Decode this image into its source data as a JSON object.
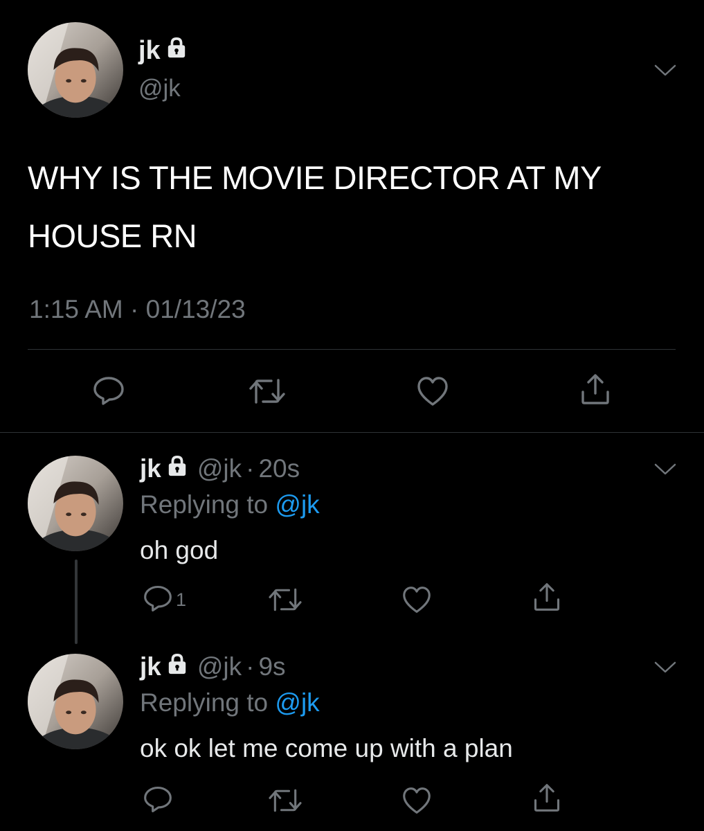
{
  "main_tweet": {
    "display_name": "jk",
    "handle": "@jk",
    "text": "WHY IS THE MOVIE DIRECTOR AT MY HOUSE RN",
    "time": "1:15 AM",
    "date": "01/13/23",
    "separator": "·"
  },
  "replies": [
    {
      "display_name": "jk",
      "handle": "@jk",
      "separator": "·",
      "age": "20s",
      "replying_prefix": "Replying to",
      "replying_to": "@jk",
      "text": "oh god",
      "reply_count": "1"
    },
    {
      "display_name": "jk",
      "handle": "@jk",
      "separator": "·",
      "age": "9s",
      "replying_prefix": "Replying to",
      "replying_to": "@jk",
      "text": "ok ok let me come up with a plan",
      "reply_count": ""
    }
  ],
  "icons": {
    "reply": "speech-bubble-icon",
    "retweet": "retweet-icon",
    "like": "heart-icon",
    "share": "share-icon",
    "lock": "lock-icon",
    "more": "chevron-down-icon"
  },
  "colors": {
    "background": "#000000",
    "text_primary": "#e7e9ea",
    "text_secondary": "#71767b",
    "accent": "#1d9bf0",
    "divider": "#2f3336"
  }
}
